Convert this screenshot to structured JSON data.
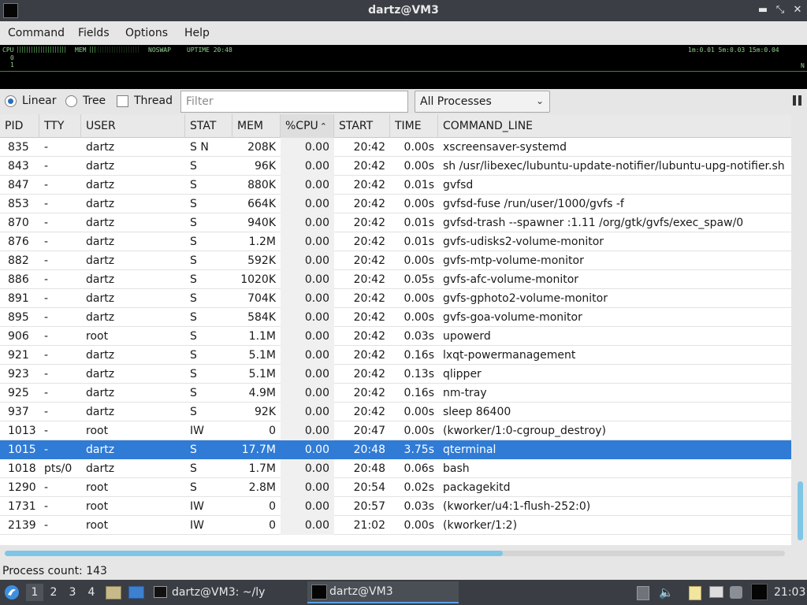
{
  "window": {
    "title": "dartz@VM3"
  },
  "menu": [
    "Command",
    "Fields",
    "Options",
    "Help"
  ],
  "meters": {
    "cpu_label": "CPU",
    "cpu_zero": "0",
    "cpu_one": "1",
    "mem_label": "MEM",
    "swap_label": "NOSWAP",
    "uptime_label": "UPTIME 20:48",
    "loadavg": "1m:0.01 5m:0.03 15m:0.04",
    "right_mark": "N"
  },
  "toolbar": {
    "linear": "Linear",
    "tree": "Tree",
    "thread": "Thread",
    "filter_placeholder": "Filter",
    "process_filter": "All Processes"
  },
  "table": {
    "columns": [
      "PID",
      "TTY",
      "USER",
      "STAT",
      "MEM",
      "%CPU",
      "START",
      "TIME",
      "COMMAND_LINE"
    ],
    "sorted_column": "%CPU",
    "rows": [
      {
        "pid": "835",
        "tty": "-",
        "user": "dartz",
        "stat": "S N",
        "mem": "208K",
        "cpu": "0.00",
        "start": "20:42",
        "time": "0.00s",
        "cmd": "xscreensaver-systemd"
      },
      {
        "pid": "843",
        "tty": "-",
        "user": "dartz",
        "stat": "S",
        "mem": "96K",
        "cpu": "0.00",
        "start": "20:42",
        "time": "0.00s",
        "cmd": "sh /usr/libexec/lubuntu-update-notifier/lubuntu-upg-notifier.sh"
      },
      {
        "pid": "847",
        "tty": "-",
        "user": "dartz",
        "stat": "S",
        "mem": "880K",
        "cpu": "0.00",
        "start": "20:42",
        "time": "0.01s",
        "cmd": "gvfsd"
      },
      {
        "pid": "853",
        "tty": "-",
        "user": "dartz",
        "stat": "S",
        "mem": "664K",
        "cpu": "0.00",
        "start": "20:42",
        "time": "0.00s",
        "cmd": "gvfsd-fuse /run/user/1000/gvfs -f"
      },
      {
        "pid": "870",
        "tty": "-",
        "user": "dartz",
        "stat": "S",
        "mem": "940K",
        "cpu": "0.00",
        "start": "20:42",
        "time": "0.01s",
        "cmd": "gvfsd-trash --spawner :1.11 /org/gtk/gvfs/exec_spaw/0"
      },
      {
        "pid": "876",
        "tty": "-",
        "user": "dartz",
        "stat": "S",
        "mem": "1.2M",
        "cpu": "0.00",
        "start": "20:42",
        "time": "0.01s",
        "cmd": "gvfs-udisks2-volume-monitor"
      },
      {
        "pid": "882",
        "tty": "-",
        "user": "dartz",
        "stat": "S",
        "mem": "592K",
        "cpu": "0.00",
        "start": "20:42",
        "time": "0.00s",
        "cmd": "gvfs-mtp-volume-monitor"
      },
      {
        "pid": "886",
        "tty": "-",
        "user": "dartz",
        "stat": "S",
        "mem": "1020K",
        "cpu": "0.00",
        "start": "20:42",
        "time": "0.05s",
        "cmd": "gvfs-afc-volume-monitor"
      },
      {
        "pid": "891",
        "tty": "-",
        "user": "dartz",
        "stat": "S",
        "mem": "704K",
        "cpu": "0.00",
        "start": "20:42",
        "time": "0.00s",
        "cmd": "gvfs-gphoto2-volume-monitor"
      },
      {
        "pid": "895",
        "tty": "-",
        "user": "dartz",
        "stat": "S",
        "mem": "584K",
        "cpu": "0.00",
        "start": "20:42",
        "time": "0.00s",
        "cmd": "gvfs-goa-volume-monitor"
      },
      {
        "pid": "906",
        "tty": "-",
        "user": "root",
        "stat": "S",
        "mem": "1.1M",
        "cpu": "0.00",
        "start": "20:42",
        "time": "0.03s",
        "cmd": "upowerd"
      },
      {
        "pid": "921",
        "tty": "-",
        "user": "dartz",
        "stat": "S",
        "mem": "5.1M",
        "cpu": "0.00",
        "start": "20:42",
        "time": "0.16s",
        "cmd": "lxqt-powermanagement"
      },
      {
        "pid": "923",
        "tty": "-",
        "user": "dartz",
        "stat": "S",
        "mem": "5.1M",
        "cpu": "0.00",
        "start": "20:42",
        "time": "0.13s",
        "cmd": "qlipper"
      },
      {
        "pid": "925",
        "tty": "-",
        "user": "dartz",
        "stat": "S",
        "mem": "4.9M",
        "cpu": "0.00",
        "start": "20:42",
        "time": "0.16s",
        "cmd": "nm-tray"
      },
      {
        "pid": "937",
        "tty": "-",
        "user": "dartz",
        "stat": "S",
        "mem": "92K",
        "cpu": "0.00",
        "start": "20:42",
        "time": "0.00s",
        "cmd": "sleep 86400"
      },
      {
        "pid": "1013",
        "tty": "-",
        "user": "root",
        "stat": "IW",
        "mem": "0",
        "cpu": "0.00",
        "start": "20:47",
        "time": "0.00s",
        "cmd": "(kworker/1:0-cgroup_destroy)"
      },
      {
        "pid": "1015",
        "tty": "-",
        "user": "dartz",
        "stat": "S",
        "mem": "17.7M",
        "cpu": "0.00",
        "start": "20:48",
        "time": "3.75s",
        "cmd": "qterminal",
        "selected": true
      },
      {
        "pid": "1018",
        "tty": "pts/0",
        "user": "dartz",
        "stat": "S",
        "mem": "1.7M",
        "cpu": "0.00",
        "start": "20:48",
        "time": "0.06s",
        "cmd": "bash"
      },
      {
        "pid": "1290",
        "tty": "-",
        "user": "root",
        "stat": "S",
        "mem": "2.8M",
        "cpu": "0.00",
        "start": "20:54",
        "time": "0.02s",
        "cmd": "packagekitd"
      },
      {
        "pid": "1731",
        "tty": "-",
        "user": "root",
        "stat": "IW",
        "mem": "0",
        "cpu": "0.00",
        "start": "20:57",
        "time": "0.03s",
        "cmd": "(kworker/u4:1-flush-252:0)"
      },
      {
        "pid": "2139",
        "tty": "-",
        "user": "root",
        "stat": "IW",
        "mem": "0",
        "cpu": "0.00",
        "start": "21:02",
        "time": "0.00s",
        "cmd": "(kworker/1:2)"
      }
    ]
  },
  "status": {
    "text": "Process count: 143"
  },
  "taskbar": {
    "workspaces": [
      "1",
      "2",
      "3",
      "4"
    ],
    "active_workspace": "1",
    "tasks": [
      "dartz@VM3: ~/ly",
      "dartz@VM3"
    ],
    "clock": "21:03"
  },
  "colors": {
    "selection": "#2f7bd6",
    "accent_scroll": "#7fc6e6",
    "meter_green": "#8fd18f"
  },
  "icons": [
    "app-terminal-icon",
    "minimize-icon",
    "restore-icon",
    "close-icon",
    "pause-icon",
    "chevron-down-icon",
    "start-menu-icon",
    "file-manager-icon",
    "desktop-icon",
    "terminal-icon",
    "volume-icon",
    "clipboard-icon",
    "network-icon",
    "update-icon"
  ]
}
